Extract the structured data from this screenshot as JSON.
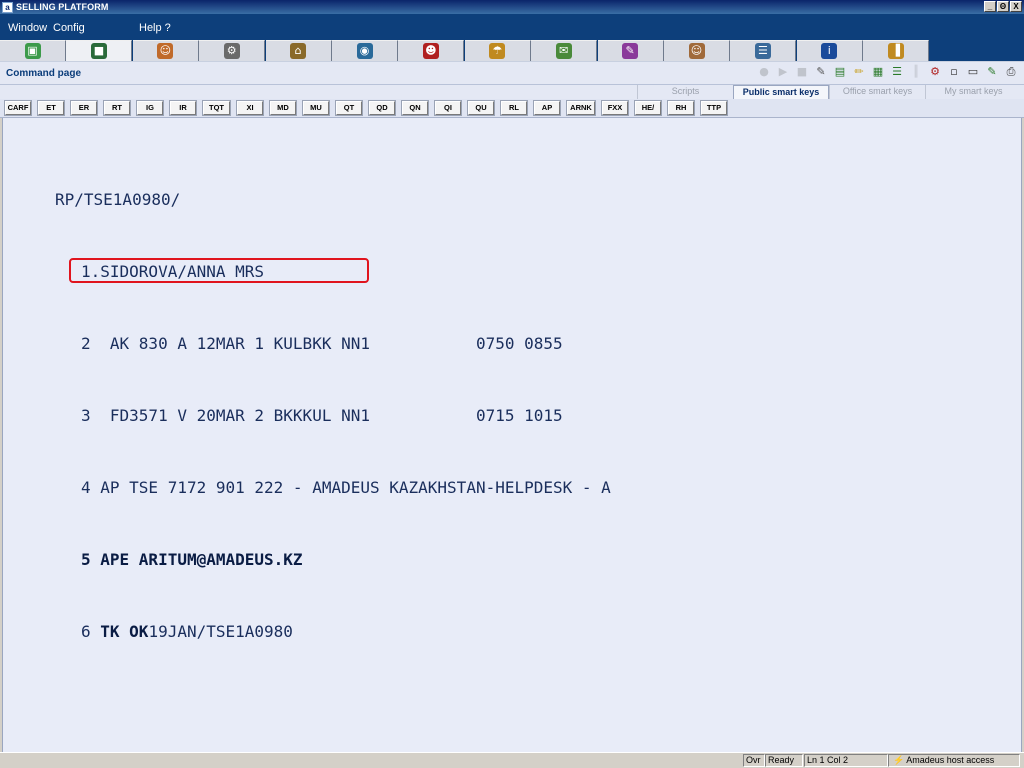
{
  "window": {
    "title": "SELLING PLATFORM",
    "app_icon": "a",
    "controls": [
      "_",
      "Θ",
      "X"
    ]
  },
  "menu": {
    "items": [
      "Window",
      "Config",
      "Help ?"
    ]
  },
  "icon_tabs": [
    {
      "icon": "cube-icon",
      "glyph": "▣",
      "color": "#3c9a4a"
    },
    {
      "icon": "terminal-icon",
      "glyph": "■",
      "color": "#2a6a3a",
      "active": true
    },
    {
      "icon": "person-icon",
      "glyph": "☺",
      "color": "#c06a2a"
    },
    {
      "icon": "gears-icon",
      "glyph": "⚙",
      "color": "#6a6a6a"
    },
    {
      "icon": "hotel-icon",
      "glyph": "⌂",
      "color": "#8a6a2a"
    },
    {
      "icon": "car-icon",
      "glyph": "◉",
      "color": "#2a6a9a"
    },
    {
      "icon": "bellboy-icon",
      "glyph": "☻",
      "color": "#b02020"
    },
    {
      "icon": "umbrella-icon",
      "glyph": "☂",
      "color": "#c08a20"
    },
    {
      "icon": "ticket-icon",
      "glyph": "✉",
      "color": "#4a8a3a"
    },
    {
      "icon": "document-icon",
      "glyph": "✎",
      "color": "#8a3a9a"
    },
    {
      "icon": "agent-icon",
      "glyph": "☺",
      "color": "#a06a3a"
    },
    {
      "icon": "files-icon",
      "glyph": "☰",
      "color": "#3a6a9a"
    },
    {
      "icon": "info-icon",
      "glyph": "i",
      "color": "#1a4a9a"
    },
    {
      "icon": "stats-icon",
      "glyph": "▐",
      "color": "#c08a20"
    }
  ],
  "command_page": {
    "title": "Command page",
    "toolbar_icons": [
      "record-icon",
      "play-icon",
      "stop-icon",
      "print-icon",
      "copy-icon",
      "paint-icon",
      "paste-icon",
      "list-icon",
      "columns-icon",
      "tools-icon",
      "clipboard-icon",
      "window-icon",
      "pen-icon",
      "printer-icon"
    ]
  },
  "smart_tabs": [
    {
      "label": "Scripts"
    },
    {
      "label": "Public smart keys",
      "active": true
    },
    {
      "label": "Office smart keys"
    },
    {
      "label": "My smart keys"
    }
  ],
  "smart_keys": [
    "CARF",
    "ET",
    "ER",
    "RT",
    "IG",
    "IR",
    "TQT",
    "XI",
    "MD",
    "MU",
    "QT",
    "QD",
    "QN",
    "QI",
    "QU",
    "RL",
    "AP",
    "ARNK",
    "FXX",
    "HE/",
    "RH",
    "TTP"
  ],
  "pnr": {
    "header": "RP/TSE1A0980/",
    "name_line": "1.SIDOROVA/ANNA MRS",
    "segment_2": "2  AK 830 A 12MAR 1 KULBKK NN1           0750 0855",
    "segment_3": "3  FD3571 V 20MAR 2 BKKKUL NN1           0715 1015",
    "line_4": "4 AP TSE 7172 901 222 - AMADEUS KAZAKHSTAN-HELPDESK - A",
    "line_5_num": "5 ",
    "line_5_bold": "APE ARITUM@AMADEUS.KZ",
    "line_6_num": "6 ",
    "line_6_bold": "TK OK",
    "line_6_rest": "19JAN/TSE1A0980"
  },
  "status": {
    "ovr": "Ovr",
    "ready": "Ready",
    "position": "Ln 1 Col 2",
    "host": "Amadeus host access"
  }
}
